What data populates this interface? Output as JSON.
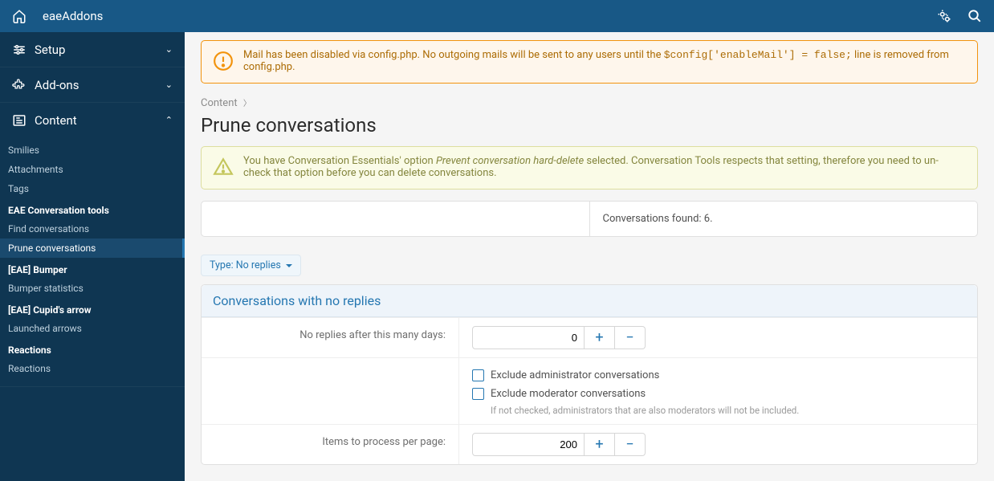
{
  "header": {
    "brand": "eaeAddons"
  },
  "sidebar": {
    "setup": "Setup",
    "addons": "Add-ons",
    "content": "Content",
    "content_items": {
      "smilies": "Smilies",
      "attachments": "Attachments",
      "tags": "Tags"
    },
    "groups": {
      "conv_tools": "EAE Conversation tools",
      "find": "Find conversations",
      "prune": "Prune conversations",
      "bumper": "[EAE] Bumper",
      "bumper_stats": "Bumper statistics",
      "cupid": "[EAE] Cupid's arrow",
      "launched": "Launched arrows",
      "reactions_head": "Reactions",
      "reactions": "Reactions"
    }
  },
  "alerts": {
    "mail_pre": "Mail has been disabled via config.php. No outgoing mails will be sent to any users until the ",
    "mail_code": "$config['enableMail'] = false;",
    "mail_post": " line is removed from config.php.",
    "conv_pre": "You have Conversation Essentials' option ",
    "conv_em": "Prevent conversation hard-delete",
    "conv_post": " selected. Conversation Tools respects that setting, therefore you need to un-check that option before you can delete conversations."
  },
  "breadcrumb": {
    "content": "Content"
  },
  "page_title": "Prune conversations",
  "panel": {
    "found_label": "Conversations found: ",
    "found_value": "6."
  },
  "filter": {
    "label": "Type: No replies"
  },
  "block": {
    "title": "Conversations with no replies",
    "no_replies_label": "No replies after this many days:",
    "no_replies_value": "0",
    "exclude_admin": "Exclude administrator conversations",
    "exclude_mod": "Exclude moderator conversations",
    "exclude_mod_hint": "If not checked, administrators that are also moderators will not be included.",
    "items_label": "Items to process per page:",
    "items_value": "200"
  }
}
